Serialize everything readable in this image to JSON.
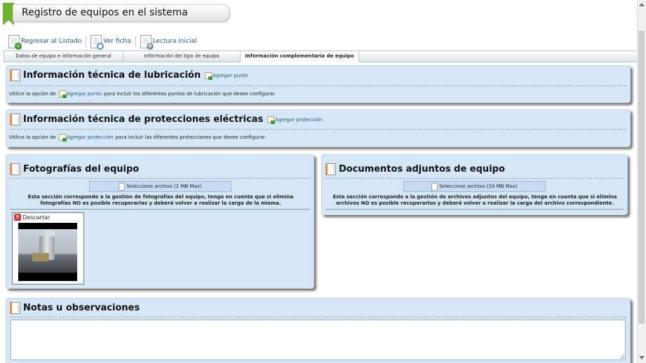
{
  "page_title": "Registro de equipos en el sistema",
  "toolbar": {
    "back_label": "Regresar al Listado",
    "view_label": "Ver ficha",
    "reading_label": "Lectura inicial"
  },
  "tabs": [
    {
      "label": "Datos de equipo e información general"
    },
    {
      "label": "Información del tipo de equipo"
    },
    {
      "label": "Información complementaria de equipo"
    }
  ],
  "lubrication": {
    "title": "Información técnica de lubricación",
    "add_label": "Agregar punto",
    "desc_prefix": "Utilice la opción de",
    "desc_link": "Agregar punto",
    "desc_suffix": "para incluir los diferentes puntos de lubricación que desee configurar"
  },
  "electrical": {
    "title": "Información técnica de protecciones eléctricas",
    "add_label": "Agregar protección",
    "desc_prefix": "Utilice la opción de",
    "desc_link": "Agregar protección",
    "desc_suffix": "para incluir las diferentes protecciones que desee configurar"
  },
  "photos": {
    "title": "Fotografías del equipo",
    "upload_label": "Seleccione archivo",
    "upload_limit": "(2 MB Max)",
    "note": "Esta sección corresponde a la gestión de fotografías del equipo, tenga en cuenta que si elimina fotografías NO es posible recuperarlas y deberá volver a realizar la carga de la misma.",
    "discard_label": "Descartar"
  },
  "documents": {
    "title": "Documentos adjuntos de equipo",
    "upload_label": "Seleccione archivo",
    "upload_limit": "(10 MB Max)",
    "note": "Esta sección corresponde a la gestión de archivos adjuntos del equipo, tenga en cuenta que si elimina archivos NO es posible recuperarlos y deberá volver a realizar la carga del archivo correspondiente."
  },
  "notes": {
    "title": "Notas u observaciones",
    "value": ""
  },
  "colors": {
    "panel_bg": "#d5e6f6",
    "accent_green": "#6cb52d",
    "link_blue": "#1e5a8a"
  }
}
